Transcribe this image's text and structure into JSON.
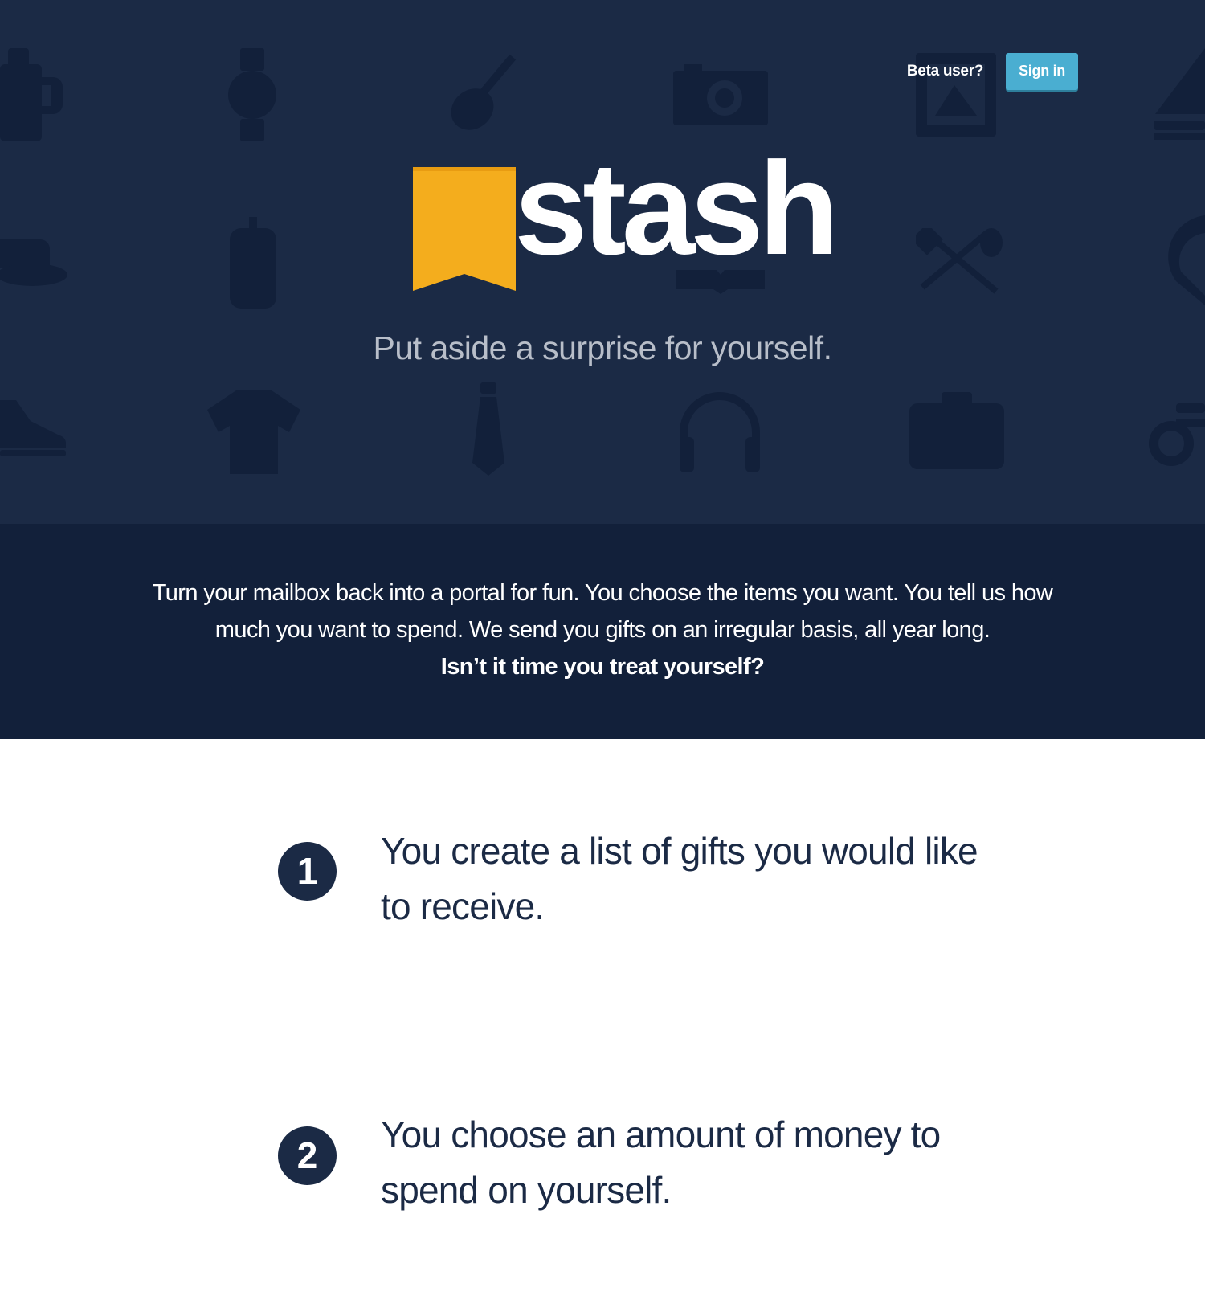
{
  "header": {
    "beta_label": "Beta user?",
    "signin_label": "Sign in"
  },
  "brand": {
    "name": "stash",
    "accent_color": "#f4ad1d",
    "background_color": "#1b2a45"
  },
  "hero": {
    "tagline": "Put aside a surprise for yourself.",
    "background_icons": [
      "beer-mug-icon",
      "watch-icon",
      "guitar-icon",
      "camera-icon",
      "stamp-icon",
      "sailboat-icon",
      "hat-icon",
      "mobile-phone-icon",
      "book-icon",
      "fork-spoon-icon",
      "horseshoe-icon",
      "sneaker-icon",
      "tshirt-icon",
      "necktie-icon",
      "headphones-icon",
      "suitcase-icon",
      "bicycle-icon"
    ]
  },
  "intro": {
    "text": "Turn your mailbox back into a portal for fun. You choose the items you want. You tell us how much you want to spend. We send you gifts on an irregular basis, all year long.",
    "cta": "Isn’t it time you treat yourself?"
  },
  "steps": [
    {
      "number": "1",
      "text": "You create a list of gifts you would like to receive."
    },
    {
      "number": "2",
      "text": "You choose an amount of money to spend on yourself."
    }
  ]
}
